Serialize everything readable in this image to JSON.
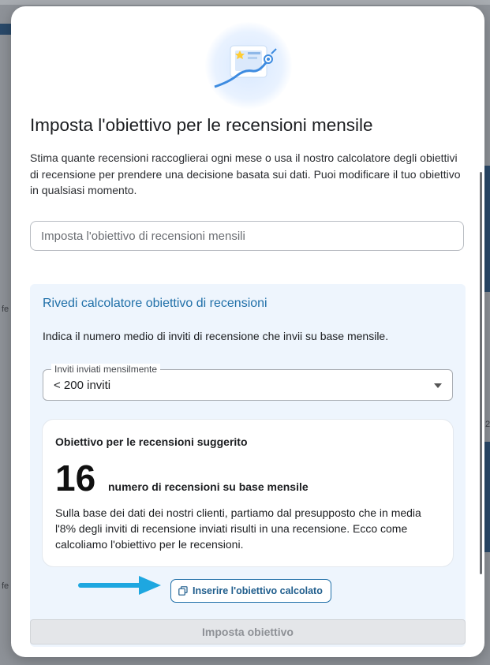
{
  "background": {
    "left_snippets": [
      "fe",
      "fe"
    ],
    "right_snippet": "2"
  },
  "modal": {
    "title": "Imposta l'obiettivo per le recensioni mensile",
    "description": "Stima quante recensioni raccoglierai ogni mese o usa il nostro calcolatore degli obiettivi di recensione per prendere una decisione basata sui dati. Puoi modificare il tuo obiettivo in qualsiasi momento.",
    "goal_input": {
      "placeholder": "Imposta l'obiettivo di recensioni mensili",
      "value": ""
    },
    "calculator": {
      "title": "Rivedi calcolatore obiettivo di recensioni",
      "instruction": "Indica il numero medio di inviti di recensione che invii su base mensile.",
      "select": {
        "label": "Inviti inviati mensilmente",
        "value": "< 200 inviti"
      },
      "suggestion": {
        "title": "Obiettivo per le recensioni suggerito",
        "number": "16",
        "number_label": "numero di recensioni su base mensile",
        "note": "Sulla base dei dati dei nostri clienti, partiamo dal presupposto che in media l'8% degli inviti di recensione inviati risulti in una recensione. Ecco come calcoliamo l'obiettivo per le recensioni."
      },
      "apply_button": "Inserire l'obiettivo calcolato",
      "apply_icon": "copy-icon"
    },
    "submit_button": "Imposta obiettivo"
  },
  "colors": {
    "accent": "#1f6fa8",
    "calculator_bg": "#eef5fd",
    "arrow": "#1ea7e0"
  }
}
